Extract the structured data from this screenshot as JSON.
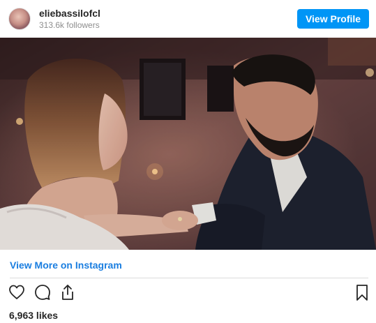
{
  "header": {
    "username": "eliebassilofcl",
    "followers": "313.6k followers",
    "view_profile_label": "View Profile"
  },
  "post": {
    "view_more_label": "View More on Instagram",
    "likes": "6,963 likes"
  },
  "icons": [
    "heart-icon",
    "comment-icon",
    "share-icon",
    "bookmark-icon"
  ],
  "colors": {
    "button_blue": "#0095f6",
    "link_blue": "#1a7ee0",
    "text": "#262626",
    "muted": "#8e8e8e"
  }
}
